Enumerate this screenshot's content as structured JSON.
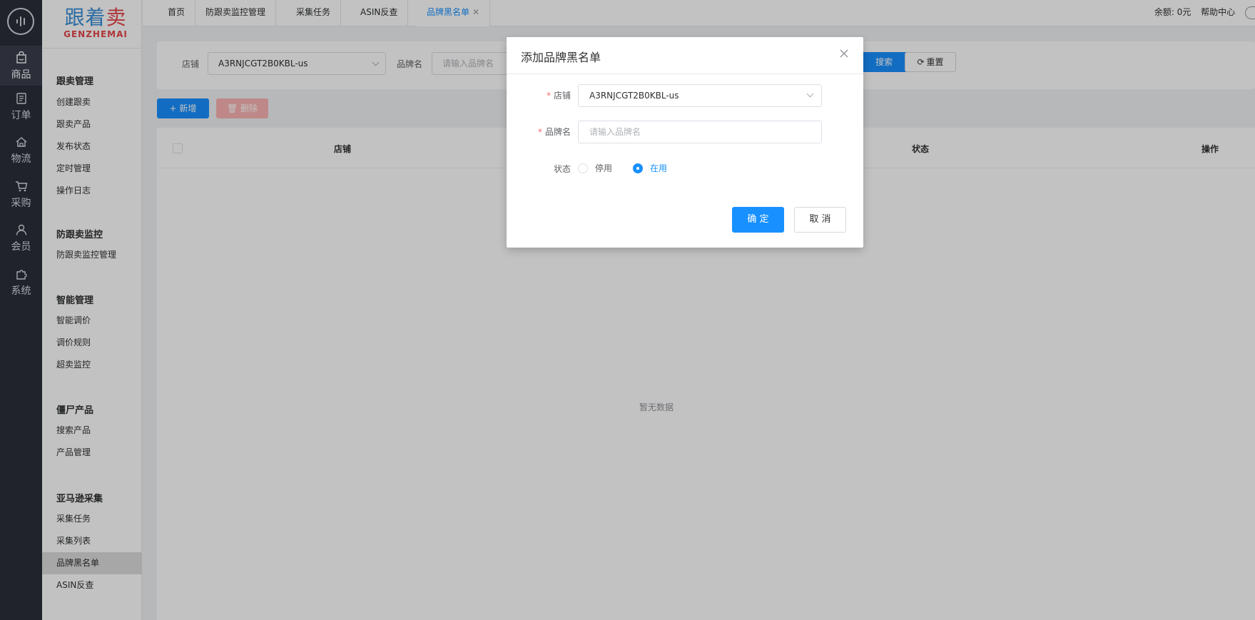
{
  "rail": {
    "items": [
      {
        "label": "商品",
        "icon": "shopping-bag-icon"
      },
      {
        "label": "订单",
        "icon": "document-icon"
      },
      {
        "label": "物流",
        "icon": "warehouse-icon"
      },
      {
        "label": "采购",
        "icon": "cart-icon"
      },
      {
        "label": "会员",
        "icon": "user-icon"
      },
      {
        "label": "系统",
        "icon": "puzzle-icon"
      }
    ]
  },
  "brand": {
    "cn_a": "跟着",
    "cn_b": "卖",
    "en": "GENZHEMAI"
  },
  "submenu": {
    "groups": [
      {
        "title": "跟卖管理",
        "items": [
          "创建跟卖",
          "跟卖产品",
          "发布状态",
          "定时管理",
          "操作日志"
        ]
      },
      {
        "title": "防跟卖监控",
        "items": [
          "防跟卖监控管理"
        ]
      },
      {
        "title": "智能管理",
        "items": [
          "智能调价",
          "调价规则",
          "超卖监控"
        ]
      },
      {
        "title": "僵尸产品",
        "items": [
          "搜索产品",
          "产品管理"
        ]
      },
      {
        "title": "亚马逊采集",
        "items": [
          "采集任务",
          "采集列表",
          "品牌黑名单",
          "ASIN反查"
        ]
      }
    ],
    "active_item": "品牌黑名单"
  },
  "tabs": [
    {
      "label": "首页"
    },
    {
      "label": "防跟卖监控管理"
    },
    {
      "label": "采集任务"
    },
    {
      "label": "ASIN反查"
    },
    {
      "label": "品牌黑名单",
      "active": true
    }
  ],
  "tab_close": "✕",
  "top_right": {
    "balance": "余额: 0元",
    "help": "帮助中心"
  },
  "filter": {
    "shop_label": "店铺",
    "shop_value": "A3RNJCGT2B0KBL-us",
    "brand_label": "品牌名",
    "brand_placeholder": "请输入品牌名",
    "search_label": "搜索",
    "reset_label": "重置"
  },
  "actions": {
    "add_label": "新增",
    "delete_label": "删除"
  },
  "table": {
    "columns": [
      "店铺",
      "状态",
      "操作"
    ],
    "empty_text": "暂无数据"
  },
  "dialog": {
    "title": "添加品牌黑名单",
    "shop_label": "店铺",
    "shop_value": "A3RNJCGT2B0KBL-us",
    "brand_label": "品牌名",
    "brand_placeholder": "请输入品牌名",
    "status_label": "状态",
    "status_options": [
      "停用",
      "在用"
    ],
    "status_selected": "在用",
    "required_mark": "*",
    "confirm_label": "确 定",
    "cancel_label": "取 消"
  },
  "colors": {
    "primary": "#1890ff",
    "danger_light": "#fbb3b3",
    "rail_bg": "#2b2f3a",
    "brand_blue": "#3b8fd8",
    "brand_red": "#e6454a"
  }
}
